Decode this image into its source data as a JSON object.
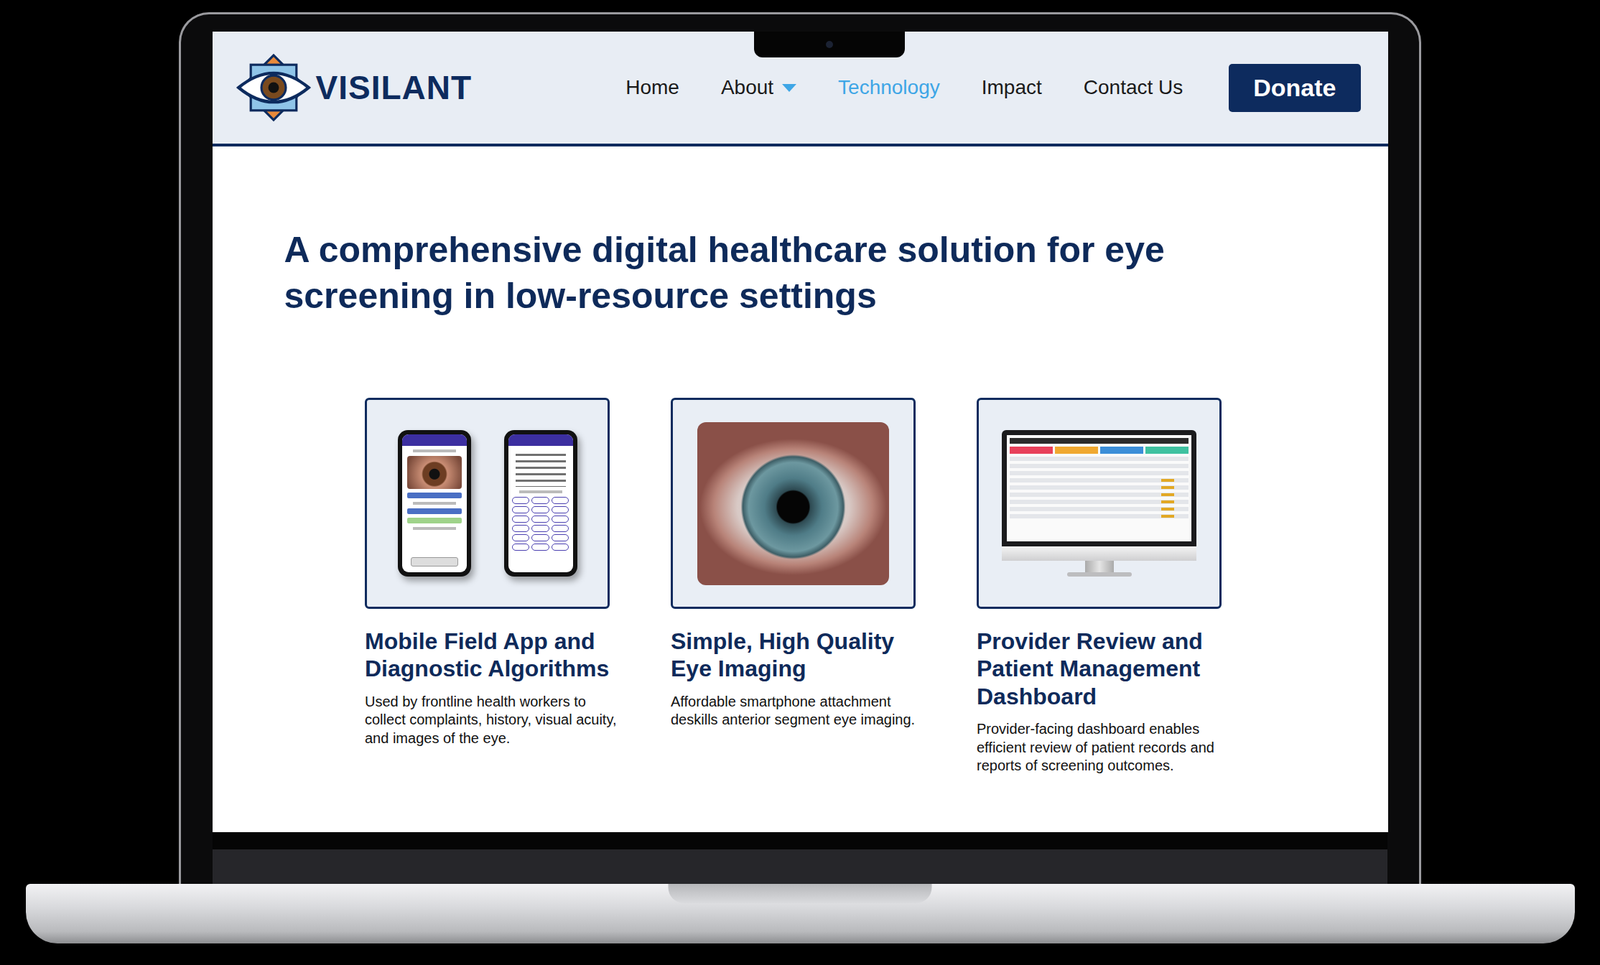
{
  "logo": {
    "text": "VISILANT"
  },
  "nav": {
    "items": [
      {
        "label": "Home",
        "selected": false,
        "expandable": false
      },
      {
        "label": "About",
        "selected": false,
        "expandable": true
      },
      {
        "label": "Technology",
        "selected": true,
        "expandable": false
      },
      {
        "label": "Impact",
        "selected": false,
        "expandable": false
      },
      {
        "label": "Contact Us",
        "selected": false,
        "expandable": false
      }
    ],
    "donate": "Donate"
  },
  "headline": "A comprehensive digital healthcare solution for eye screening in low-resource settings",
  "cards": [
    {
      "kind": "phones",
      "title": "Mobile Field App and Diagnostic Algorithms",
      "description": "Used by frontline health workers to collect complaints, history, visual acuity, and images of the eye."
    },
    {
      "kind": "photo",
      "title": "Simple, High Quality Eye Imaging",
      "description": "Affordable smartphone attachment deskills anterior segment eye imaging."
    },
    {
      "kind": "dashboard",
      "title": "Provider Review and Patient Management Dashboard",
      "description": "Provider-facing dashboard enables efficient review of patient records and reports of screening outcomes."
    }
  ]
}
